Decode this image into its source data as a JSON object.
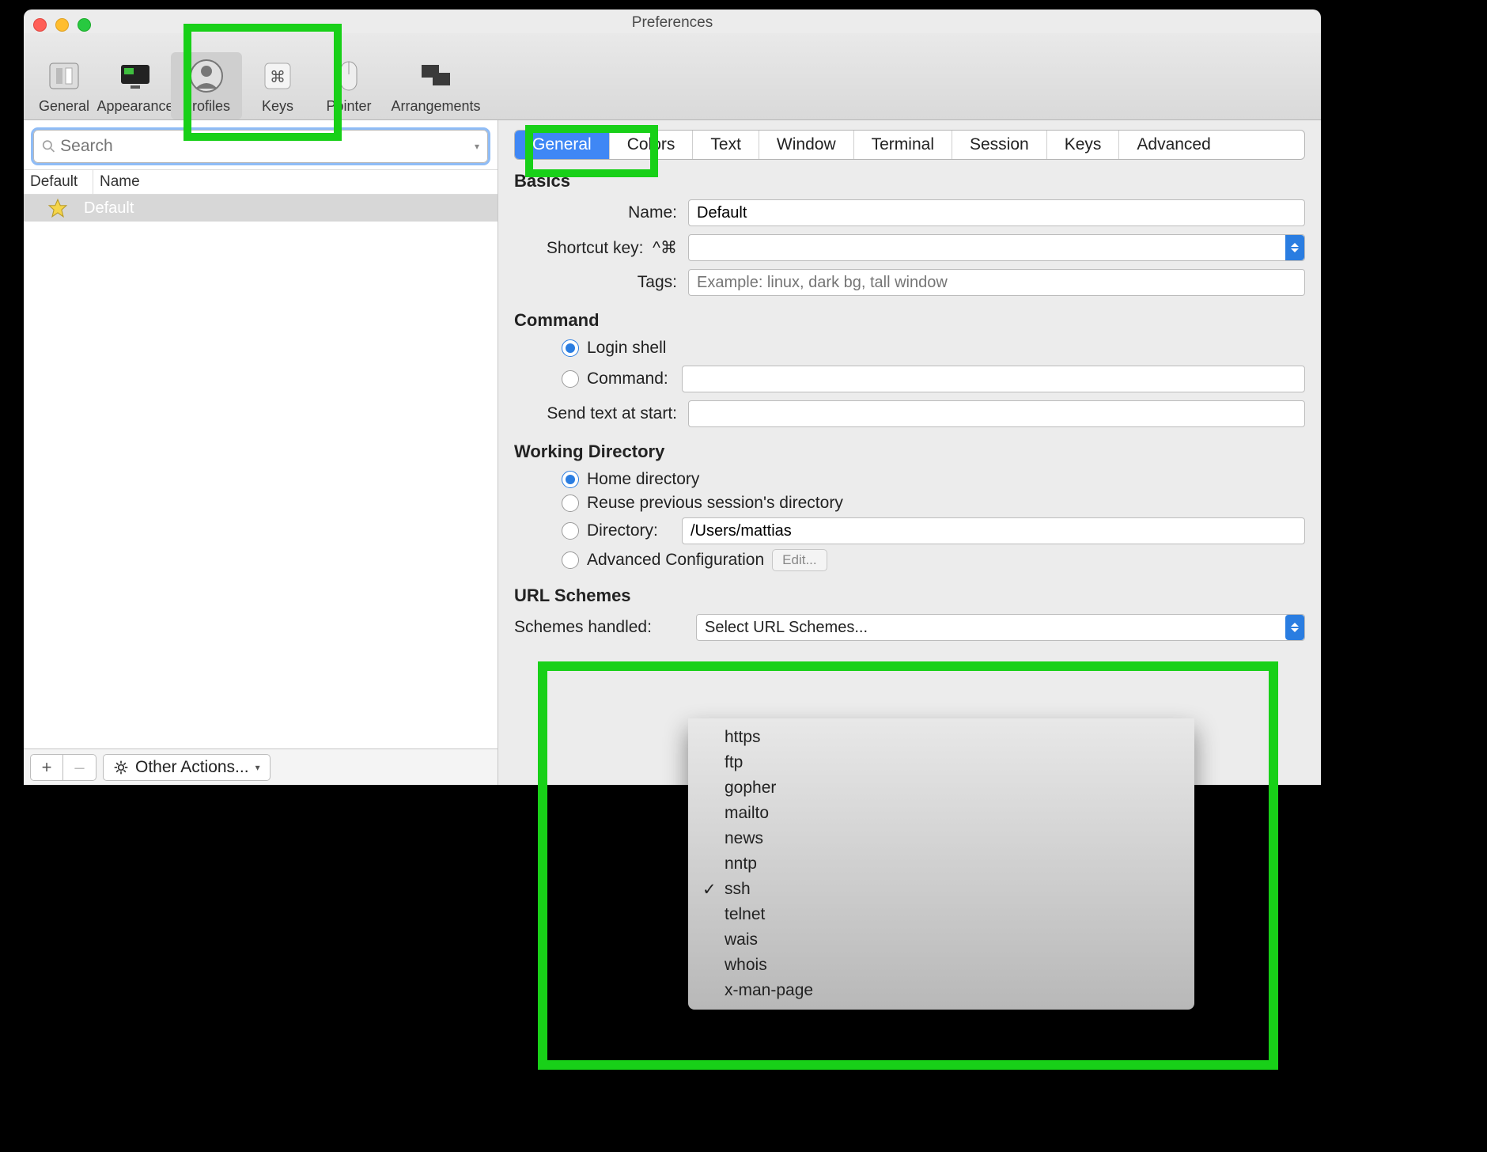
{
  "window": {
    "title": "Preferences"
  },
  "toolbar": {
    "items": [
      {
        "label": "General"
      },
      {
        "label": "Appearance"
      },
      {
        "label": "Profiles"
      },
      {
        "label": "Keys"
      },
      {
        "label": "Pointer"
      },
      {
        "label": "Arrangements"
      }
    ]
  },
  "sidebar": {
    "search_placeholder": "Search",
    "columns": {
      "default": "Default",
      "name": "Name"
    },
    "profiles": [
      {
        "name": "Default",
        "is_default": true
      }
    ],
    "add_label": "+",
    "remove_label": "–",
    "other_actions_label": "Other Actions..."
  },
  "tabs": [
    {
      "label": "General",
      "active": true
    },
    {
      "label": "Colors"
    },
    {
      "label": "Text"
    },
    {
      "label": "Window"
    },
    {
      "label": "Terminal"
    },
    {
      "label": "Session"
    },
    {
      "label": "Keys"
    },
    {
      "label": "Advanced"
    }
  ],
  "sections": {
    "basics": {
      "heading": "Basics",
      "name_label": "Name:",
      "name_value": "Default",
      "shortcut_label": "Shortcut key:",
      "shortcut_prefix": "^⌘",
      "tags_label": "Tags:",
      "tags_placeholder": "Example: linux, dark bg, tall window"
    },
    "command": {
      "heading": "Command",
      "login_shell_label": "Login shell",
      "command_label": "Command:",
      "send_text_label": "Send text at start:"
    },
    "working_dir": {
      "heading": "Working Directory",
      "home_label": "Home directory",
      "reuse_label": "Reuse previous session's directory",
      "directory_label": "Directory:",
      "directory_value": "/Users/mattias",
      "advanced_label": "Advanced Configuration",
      "edit_button": "Edit..."
    },
    "url_schemes": {
      "heading": "URL Schemes",
      "handled_label": "Schemes handled:",
      "select_placeholder": "Select URL Schemes...",
      "options": [
        {
          "label": "https"
        },
        {
          "label": "ftp"
        },
        {
          "label": "gopher"
        },
        {
          "label": "mailto"
        },
        {
          "label": "news"
        },
        {
          "label": "nntp"
        },
        {
          "label": "ssh",
          "checked": true
        },
        {
          "label": "telnet"
        },
        {
          "label": "wais"
        },
        {
          "label": "whois"
        },
        {
          "label": "x-man-page"
        }
      ]
    }
  }
}
